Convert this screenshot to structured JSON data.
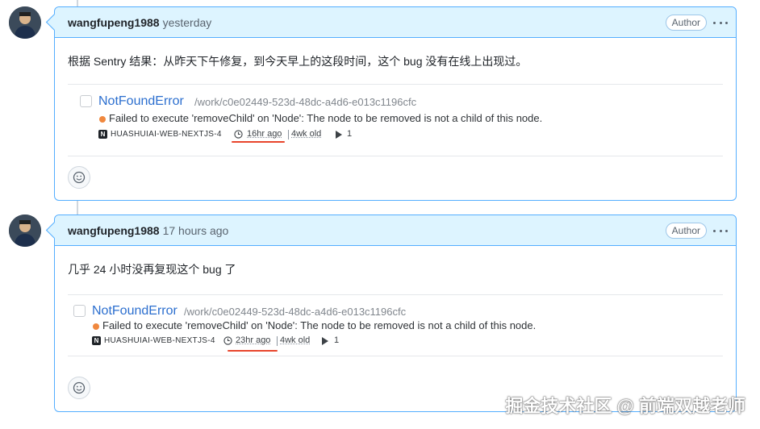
{
  "comments": [
    {
      "author": "wangfupeng1988",
      "time": "yesterday",
      "badge": "Author",
      "body": "根据 Sentry 结果：从昨天下午修复，到今天早上的这段时间，这个 bug 没有在线上出现过。",
      "issue": {
        "title": "NotFoundError",
        "path": "/work/c0e02449-523d-48dc-a4d6-e013c1196cfc",
        "message": "Failed to execute 'removeChild' on 'Node': The node to be removed is not a child of this node.",
        "project": "HUASHUIAI-WEB-NEXTJS-4",
        "last_seen": "16hr ago",
        "age": "4wk old",
        "events": "1"
      }
    },
    {
      "author": "wangfupeng1988",
      "time": "17 hours ago",
      "badge": "Author",
      "body": "几乎 24 小时没再复现这个 bug 了",
      "issue": {
        "title": "NotFoundError",
        "path": "/work/c0e02449-523d-48dc-a4d6-e013c1196cfc",
        "message": "Failed to execute 'removeChild' on 'Node': The node to be removed is not a child of this node.",
        "project": "HUASHUIAI-WEB-NEXTJS-4",
        "last_seen": "23hr ago",
        "age": "4wk old",
        "events": "1"
      }
    }
  ],
  "watermark": "掘金技术社区 @ 前端双越老师",
  "colors": {
    "header_bg": "#ddf4ff",
    "border": "#54aeff",
    "link": "#2c6fcf",
    "error_dot": "#f0883e",
    "highlight_underline": "#e8452c"
  },
  "icons": {
    "avatar": "avatar",
    "more": "kebab-icon",
    "clock": "clock-icon",
    "play": "play-icon",
    "emoji": "smiley-icon",
    "project": "nextjs-icon"
  }
}
